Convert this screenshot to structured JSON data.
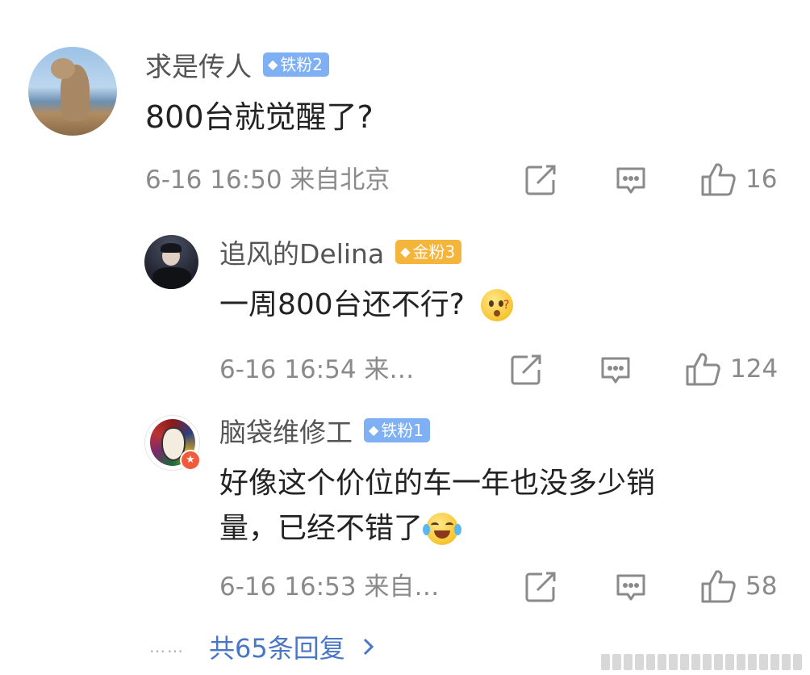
{
  "comments": [
    {
      "username": "求是传人",
      "badge": "铁粉2",
      "text": "800台就觉醒了?",
      "meta": "6-16 16:50 来自北京",
      "likes": "16"
    },
    {
      "username": "追风的Delina",
      "badge": "金粉3",
      "text": "一周800台还不行?",
      "meta": "6-16 16:54 来…",
      "likes": "124"
    },
    {
      "username": "脑袋维修工",
      "badge": "铁粉1",
      "text_line1": "好像这个价位的车一年也没多少销",
      "text_line2": "量，已经不错了",
      "meta": "6-16 16:53 来自…",
      "likes": "58"
    }
  ],
  "more": {
    "dots": "……",
    "label": "共65条回复"
  },
  "colors": {
    "badge_iron": "#7fb0f4",
    "badge_gold": "#f5b43a",
    "link": "#4a76c6"
  }
}
